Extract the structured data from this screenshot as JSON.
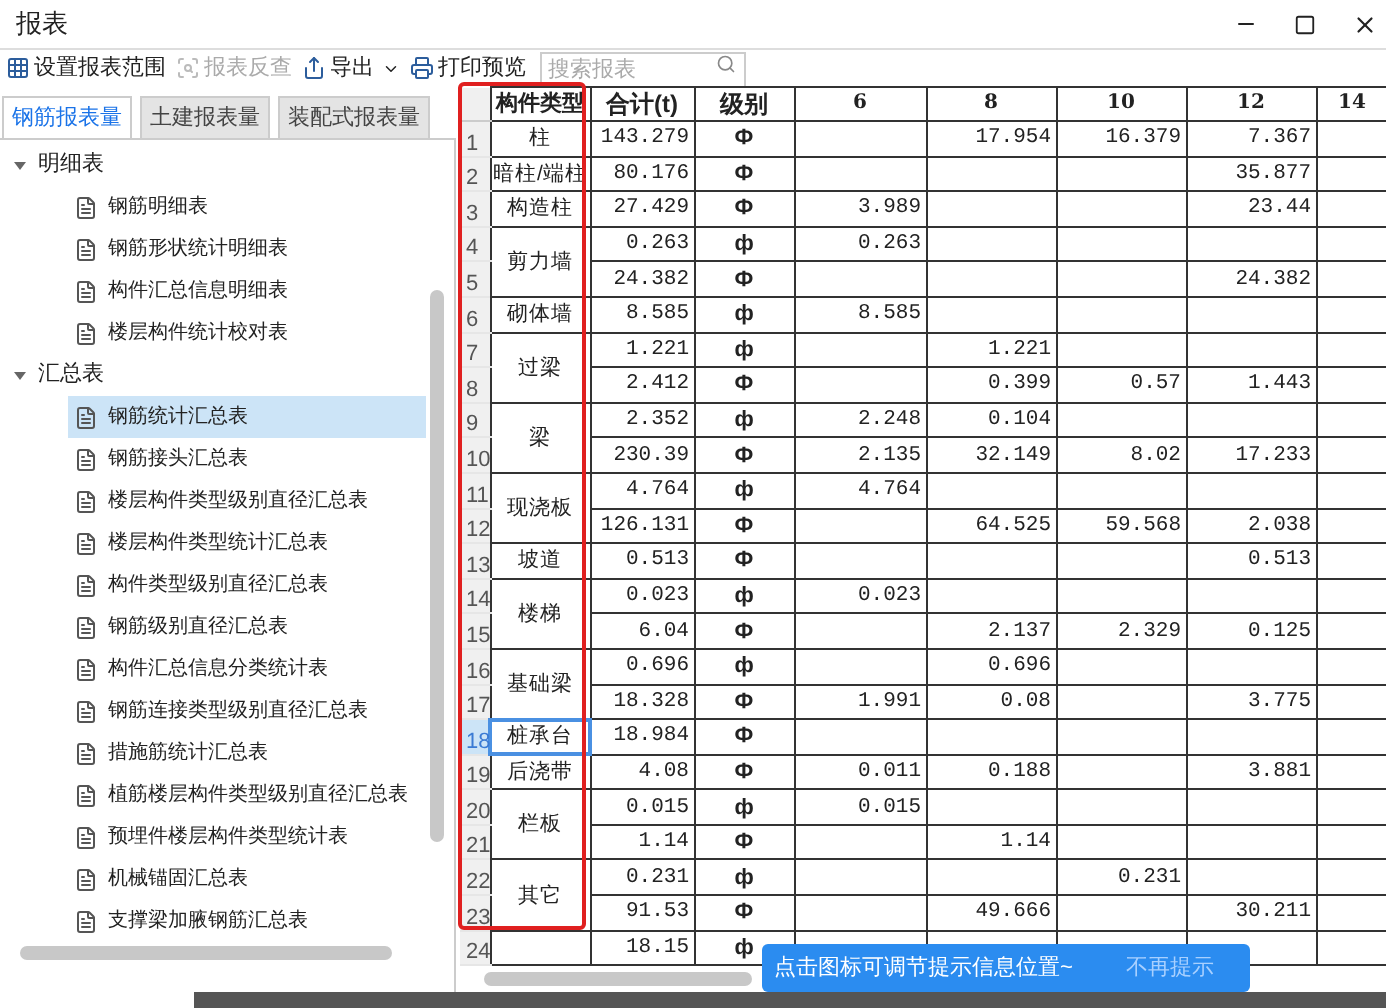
{
  "window": {
    "title": "报表"
  },
  "toolbar": [
    {
      "label": "设置报表范围",
      "kind": "range",
      "disabled": false
    },
    {
      "label": "报表反查",
      "kind": "lookup",
      "disabled": true
    },
    {
      "label": "导出",
      "kind": "export",
      "disabled": false
    },
    {
      "label": "打印预览",
      "kind": "print",
      "disabled": false
    }
  ],
  "search": {
    "placeholder": "搜索报表"
  },
  "tabs": [
    {
      "label": "钢筋报表量",
      "selected": true
    },
    {
      "label": "土建报表量",
      "selected": false
    },
    {
      "label": "装配式报表量",
      "selected": false
    }
  ],
  "tree": [
    {
      "label": "明细表",
      "expanded": true,
      "children": [
        {
          "label": "钢筋明细表",
          "selected": false
        },
        {
          "label": "钢筋形状统计明细表",
          "selected": false
        },
        {
          "label": "构件汇总信息明细表",
          "selected": false
        },
        {
          "label": "楼层构件统计校对表",
          "selected": false
        }
      ]
    },
    {
      "label": "汇总表",
      "expanded": true,
      "children": [
        {
          "label": "钢筋统计汇总表",
          "selected": true
        },
        {
          "label": "钢筋接头汇总表",
          "selected": false
        },
        {
          "label": "楼层构件类型级别直径汇总表",
          "selected": false
        },
        {
          "label": "楼层构件类型统计汇总表",
          "selected": false
        },
        {
          "label": "构件类型级别直径汇总表",
          "selected": false
        },
        {
          "label": "钢筋级别直径汇总表",
          "selected": false
        },
        {
          "label": "构件汇总信息分类统计表",
          "selected": false
        },
        {
          "label": "钢筋连接类型级别直径汇总表",
          "selected": false
        },
        {
          "label": "措施筋统计汇总表",
          "selected": false
        },
        {
          "label": "植筋楼层构件类型级别直径汇总表",
          "selected": false
        },
        {
          "label": "预埋件楼层构件类型统计表",
          "selected": false
        },
        {
          "label": "机械锚固汇总表",
          "selected": false
        },
        {
          "label": "支撑梁加腋钢筋汇总表",
          "selected": false
        }
      ]
    }
  ],
  "table": {
    "columns": [
      "构件类型",
      "合计(t)",
      "级别",
      "6",
      "8",
      "10",
      "12",
      "14"
    ],
    "groups": [
      {
        "type": "柱",
        "selected": false,
        "rows": [
          {
            "num": "1",
            "total": "143.279",
            "grade": "Ф",
            "c8": "17.954",
            "c10": "16.379",
            "c12": "7.367"
          }
        ]
      },
      {
        "type": "暗柱/端柱",
        "selected": false,
        "rows": [
          {
            "num": "2",
            "total": "80.176",
            "grade": "Ф",
            "c12": "35.877"
          }
        ]
      },
      {
        "type": "构造柱",
        "selected": false,
        "rows": [
          {
            "num": "3",
            "total": "27.429",
            "grade": "Ф",
            "c6": "3.989",
            "c12": "23.44"
          }
        ]
      },
      {
        "type": "剪力墙",
        "selected": false,
        "rows": [
          {
            "num": "4",
            "total": "0.263",
            "grade": "ф",
            "c6": "0.263"
          },
          {
            "num": "5",
            "total": "24.382",
            "grade": "Ф",
            "c12": "24.382"
          }
        ]
      },
      {
        "type": "砌体墙",
        "selected": false,
        "rows": [
          {
            "num": "6",
            "total": "8.585",
            "grade": "ф",
            "c6": "8.585"
          }
        ]
      },
      {
        "type": "过梁",
        "selected": false,
        "rows": [
          {
            "num": "7",
            "total": "1.221",
            "grade": "ф",
            "c8": "1.221"
          },
          {
            "num": "8",
            "total": "2.412",
            "grade": "Ф",
            "c8": "0.399",
            "c10": "0.57",
            "c12": "1.443"
          }
        ]
      },
      {
        "type": "梁",
        "selected": false,
        "rows": [
          {
            "num": "9",
            "total": "2.352",
            "grade": "ф",
            "c6": "2.248",
            "c8": "0.104"
          },
          {
            "num": "10",
            "total": "230.39",
            "grade": "Ф",
            "c6": "2.135",
            "c8": "32.149",
            "c10": "8.02",
            "c12": "17.233"
          }
        ]
      },
      {
        "type": "现浇板",
        "selected": false,
        "rows": [
          {
            "num": "11",
            "total": "4.764",
            "grade": "ф",
            "c6": "4.764"
          },
          {
            "num": "12",
            "total": "126.131",
            "grade": "Ф",
            "c8": "64.525",
            "c10": "59.568",
            "c12": "2.038"
          }
        ]
      },
      {
        "type": "坡道",
        "selected": false,
        "rows": [
          {
            "num": "13",
            "total": "0.513",
            "grade": "Ф",
            "c12": "0.513"
          }
        ]
      },
      {
        "type": "楼梯",
        "selected": false,
        "rows": [
          {
            "num": "14",
            "total": "0.023",
            "grade": "ф",
            "c6": "0.023"
          },
          {
            "num": "15",
            "total": "6.04",
            "grade": "Ф",
            "c8": "2.137",
            "c10": "2.329",
            "c12": "0.125"
          }
        ]
      },
      {
        "type": "基础梁",
        "selected": false,
        "rows": [
          {
            "num": "16",
            "total": "0.696",
            "grade": "ф",
            "c8": "0.696"
          },
          {
            "num": "17",
            "total": "18.328",
            "grade": "Ф",
            "c6": "1.991",
            "c8": "0.08",
            "c12": "3.775"
          }
        ]
      },
      {
        "type": "桩承台",
        "selected": true,
        "rows": [
          {
            "num": "18",
            "total": "18.984",
            "grade": "Ф"
          }
        ]
      },
      {
        "type": "后浇带",
        "selected": false,
        "rows": [
          {
            "num": "19",
            "total": "4.08",
            "grade": "Ф",
            "c6": "0.011",
            "c8": "0.188",
            "c12": "3.881"
          }
        ]
      },
      {
        "type": "栏板",
        "selected": false,
        "rows": [
          {
            "num": "20",
            "total": "0.015",
            "grade": "ф",
            "c6": "0.015"
          },
          {
            "num": "21",
            "total": "1.14",
            "grade": "Ф",
            "c8": "1.14"
          }
        ]
      },
      {
        "type": "其它",
        "selected": false,
        "rows": [
          {
            "num": "22",
            "total": "0.231",
            "grade": "ф",
            "c10": "0.231"
          },
          {
            "num": "23",
            "total": "91.53",
            "grade": "Ф",
            "c8": "49.666",
            "c12": "30.211"
          }
        ]
      },
      {
        "rows": [
          {
            "num": "24",
            "total": "18.15",
            "grade": "ф"
          }
        ]
      }
    ]
  },
  "tip": {
    "text": "点击图标可调节提示信息位置~",
    "dismiss": "不再提示"
  }
}
